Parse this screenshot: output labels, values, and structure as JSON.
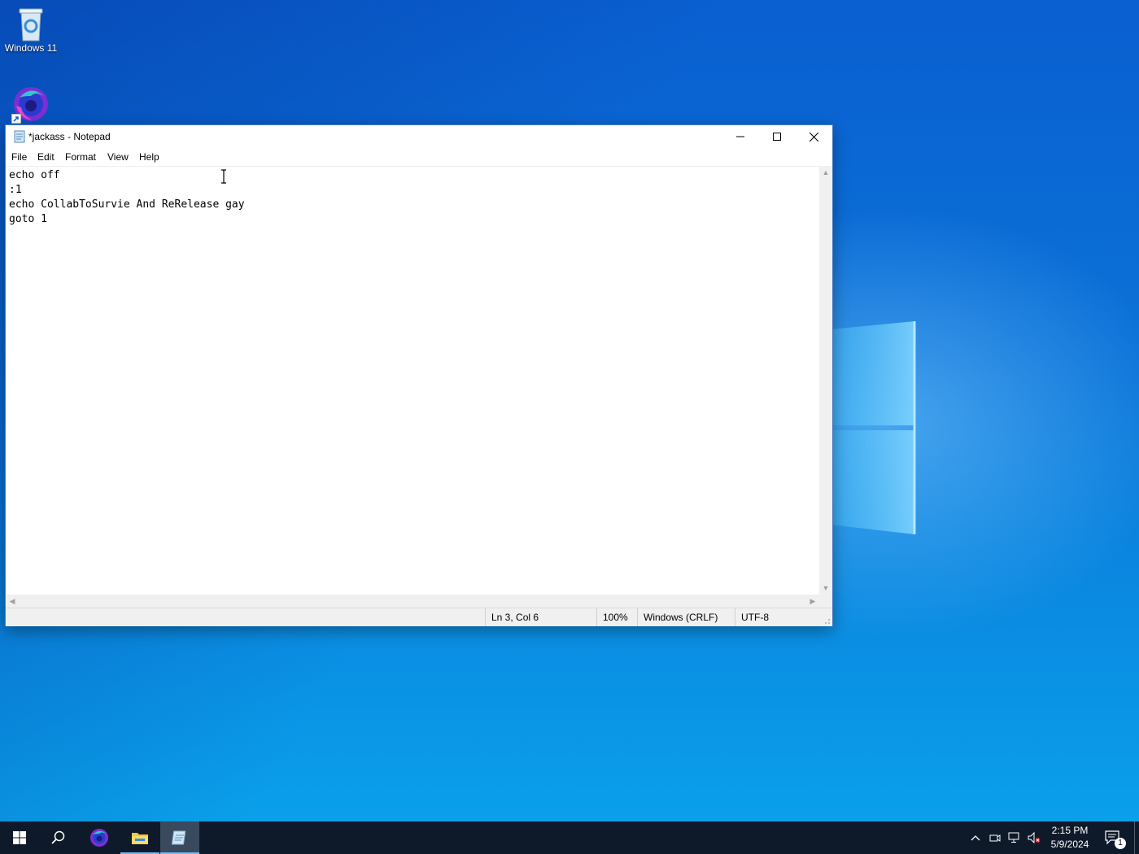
{
  "desktop": {
    "icons": [
      {
        "label": "Windows 11",
        "icon": "recycle-bin-icon"
      },
      {
        "label": "",
        "icon": "firefox-icon"
      }
    ]
  },
  "notepad": {
    "title": "*jackass - Notepad",
    "menu": [
      "File",
      "Edit",
      "Format",
      "View",
      "Help"
    ],
    "content_lines": [
      "echo off",
      ":1",
      "echo CollabToSurvie And ReRelease gay",
      "goto 1"
    ],
    "status": {
      "position": "Ln 3, Col 6",
      "zoom": "100%",
      "line_ending": "Windows (CRLF)",
      "encoding": "UTF-8"
    }
  },
  "taskbar": {
    "items": [
      "start-icon",
      "search-icon",
      "firefox-icon",
      "file-explorer-icon",
      "notepad-icon"
    ],
    "tray": [
      "chevron-up-icon",
      "meet-now-icon",
      "network-icon",
      "volume-muted-icon"
    ],
    "time": "2:15 PM",
    "date": "5/9/2024",
    "notification_count": "1"
  },
  "colors": {
    "taskbar": "#0e1a2a",
    "desktop_blue": "#0b73d8",
    "accent": "#76b9ed"
  }
}
